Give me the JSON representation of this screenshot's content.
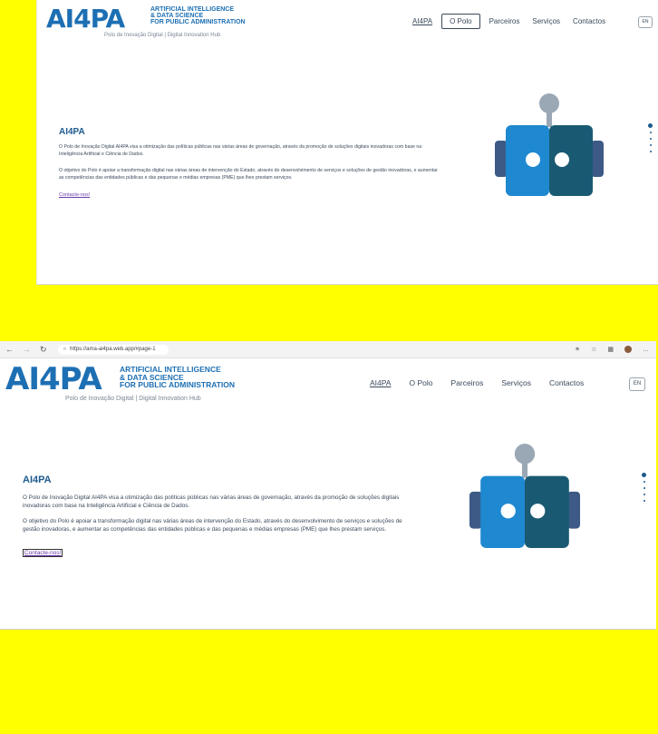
{
  "site": {
    "logo_word": "AI4PA",
    "logo_lines": [
      "ARTIFICIAL INTELLIGENCE",
      "& DATA SCIENCE",
      "FOR PUBLIC ADMINISTRATION"
    ],
    "logo_sub": "Polo de Inovação Digital | Digital Innovation Hub"
  },
  "nav": {
    "items": [
      "AI4PA",
      "O Polo",
      "Parceiros",
      "Serviços",
      "Contactos"
    ],
    "lang": "EN"
  },
  "hero": {
    "title": "AI4PA",
    "p1": "O Polo de Inovação Digital AI4PA visa a otimização das políticas públicas nas várias áreas de governação, através da promoção de soluções digitais inovadoras com base na Inteligência Artificial e Ciência de Dados.",
    "p2": "O objetivo do Polo é apoiar a transformação digital nas várias áreas de intervenção do Estado, através do desenvolvimento de serviços e soluções de gestão inovadoras, e aumentar as competências das entidades públicas e das pequenas e médias empresas (PME) que lhes prestam serviços.",
    "cta": "Contacte-nos!"
  },
  "browser": {
    "url": "https://ama-ai4pa.web.app/#page-1"
  },
  "colors": {
    "brand": "#1d6fb3",
    "robot_left": "#1e88d0",
    "robot_right": "#195a72",
    "robot_ears": "#3d5a86",
    "robot_antenna": "#9aa7b4",
    "background_highlight": "#ffff00"
  }
}
